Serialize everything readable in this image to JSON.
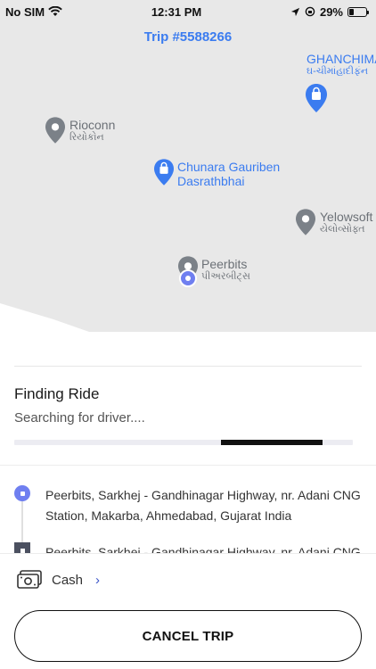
{
  "status_bar": {
    "carrier": "No SIM",
    "time": "12:31 PM",
    "battery": "29%",
    "battery_level": 0.29
  },
  "header": {
    "trip_title": "Trip #5588266"
  },
  "map": {
    "pois": [
      {
        "name": "GHANCHIMA",
        "sub": "ઘ-ચીમાંહાદીફંન",
        "style": "blue",
        "icon": "shopping-bag-pin-icon"
      },
      {
        "name": "Rioconn",
        "sub": "રિયોકોન",
        "style": "gray",
        "icon": "place-pin-icon"
      },
      {
        "name": "Chunara Gauriben",
        "sub": "Dasrathbhai",
        "style": "blue",
        "icon": "shopping-bag-pin-icon"
      },
      {
        "name": "Yelowsoft",
        "sub": "યેલોવ્સોફ્ત",
        "style": "gray",
        "icon": "place-pin-icon"
      },
      {
        "name": "Peerbits",
        "sub": "પીઅરબીટ્સ",
        "style": "gray",
        "icon": "place-pin-icon"
      }
    ],
    "accent_color": "#3b7cf0"
  },
  "ride_status": {
    "title": "Finding Ride",
    "subtitle": "Searching for driver....",
    "progress": 0.3
  },
  "route": {
    "pickup": "Peerbits, Sarkhej - Gandhinagar Highway, nr. Adani CNG Station, Makarba, Ahmedabad, Gujarat India",
    "dropoff": "Peerbits, Sarkhej - Gandhinagar Highway, nr. Adani CNG"
  },
  "payment": {
    "method": "Cash",
    "icon": "cash-icon",
    "chevron": "›"
  },
  "actions": {
    "cancel_label": "CANCEL TRIP"
  }
}
